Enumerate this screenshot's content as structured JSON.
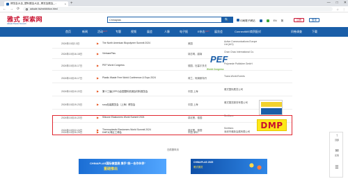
{
  "browser": {
    "tab_title": "博览会大全_塑料展会大全_博览会展会_...",
    "tab_close": "×",
    "new_tab": "+",
    "url": "adsale.hk/exhibition.html",
    "nav": {
      "back": "←",
      "forward": "→",
      "reload": "⟳"
    },
    "right_icons": [
      "☆",
      "⋮"
    ],
    "window_controls": [
      "—",
      "□",
      "✕"
    ]
  },
  "site": {
    "logo_text": "雅式 探索网",
    "logo_sub": "Adsale Plastics Network",
    "search_value": "Chinaplas",
    "search_icon": "🔍",
    "header_links": [
      {
        "label": "印刷電子網站",
        "icon_color": "#1a5ea8"
      },
      {
        "label": "",
        "icon_color": "#1a5ea8"
      },
      {
        "label": "",
        "icon_color": "#3aa635"
      },
      {
        "label": "EN",
        "icon_color": "#666666"
      },
      {
        "label": "简",
        "icon_color": "#666666"
      }
    ],
    "register_label": "注冊",
    "login_label": "登录"
  },
  "nav": {
    "home": "首页",
    "items": [
      {
        "label": "新闻",
        "hot": ""
      },
      {
        "label": "活动",
        "hot": "HOT"
      },
      {
        "label": "专题",
        "hot": ""
      },
      {
        "label": "视频",
        "hot": ""
      },
      {
        "label": "展会",
        "hot": ""
      },
      {
        "label": "人脉",
        "hot": ""
      },
      {
        "label": "电子报",
        "hot": ""
      },
      {
        "label": "E杂志",
        "hot": "HOT"
      },
      {
        "label": "展览会",
        "hot": ""
      },
      {
        "label": "ConnectMIE商贸配对",
        "hot": ""
      },
      {
        "label": "问卷调查",
        "hot": ""
      },
      {
        "label": "下载",
        "hot": ""
      }
    ]
  },
  "events": [
    {
      "date": "2024年10月2-3日",
      "name": "The North American Biopolymer Summit 2024",
      "city": "美国",
      "org": "Active Communications Europe Ltd (ACI)"
    },
    {
      "date": "2024年10月16-18日",
      "name": "VietnamPlas",
      "city": "胡志明，越南",
      "org": "Chan Chao International Co."
    },
    {
      "date": "2024年10月15-17日",
      "name": "PEF World Congress",
      "city": "德国，杜塞尔多夫",
      "org": "Polyneste Publisher GmbH"
    },
    {
      "date": "2024年10月15-17日",
      "name": "Plastic Waste Free World Conference & Expo 2024",
      "city": "荷兰，阿姆斯特丹",
      "org": "Trans-World Events"
    },
    {
      "date": "2024年10月10-22日",
      "name": "第十三届(CPRJ)全国塑料机械及材料展览会",
      "city": "中国 上海",
      "org": "雅式国际展览公司"
    },
    {
      "date": "2024年10月19-23日",
      "name": "sorp包装展览会（上海）博览会",
      "city": "中国 上海",
      "org": "雅式展览服务有限公司"
    },
    {
      "date": "2024年10月10-22日",
      "name": "Silicone Elastomers World Summit 2024",
      "city": "慕尼黑，德国",
      "org": "Smithers"
    },
    {
      "date": "2024年10月22-24日",
      "name": "Thermoplastic Elastomers World Summit 2024",
      "city": "慕尼黑，德国",
      "org": "Smithers"
    },
    {
      "date": "2024年10月26-29日",
      "name": "DMP大湾区工博会",
      "city": "中国 深圳",
      "org": "深圳市雅新会展有限公司"
    }
  ],
  "thumbnails": {
    "pef": {
      "word": "PEF",
      "sub": "World Congress"
    },
    "sign": {
      "text": ""
    },
    "dmp": {
      "word": "DMP"
    }
  },
  "pager_text": "日前按年月",
  "banners": {
    "left": {
      "line1": "CHINAPLAS国际橡塑展 携手\"统一合作伙伴\"",
      "line2": "重磅推出"
    },
    "right": {
      "line1": "CHINAPLAS 2025",
      "line2": "雅式展览"
    }
  },
  "float_widget": [
    {
      "icon": "↑",
      "label": "顶部"
    },
    {
      "icon": "✉",
      "label": "反馈"
    },
    {
      "icon": "☰",
      "label": ""
    }
  ]
}
